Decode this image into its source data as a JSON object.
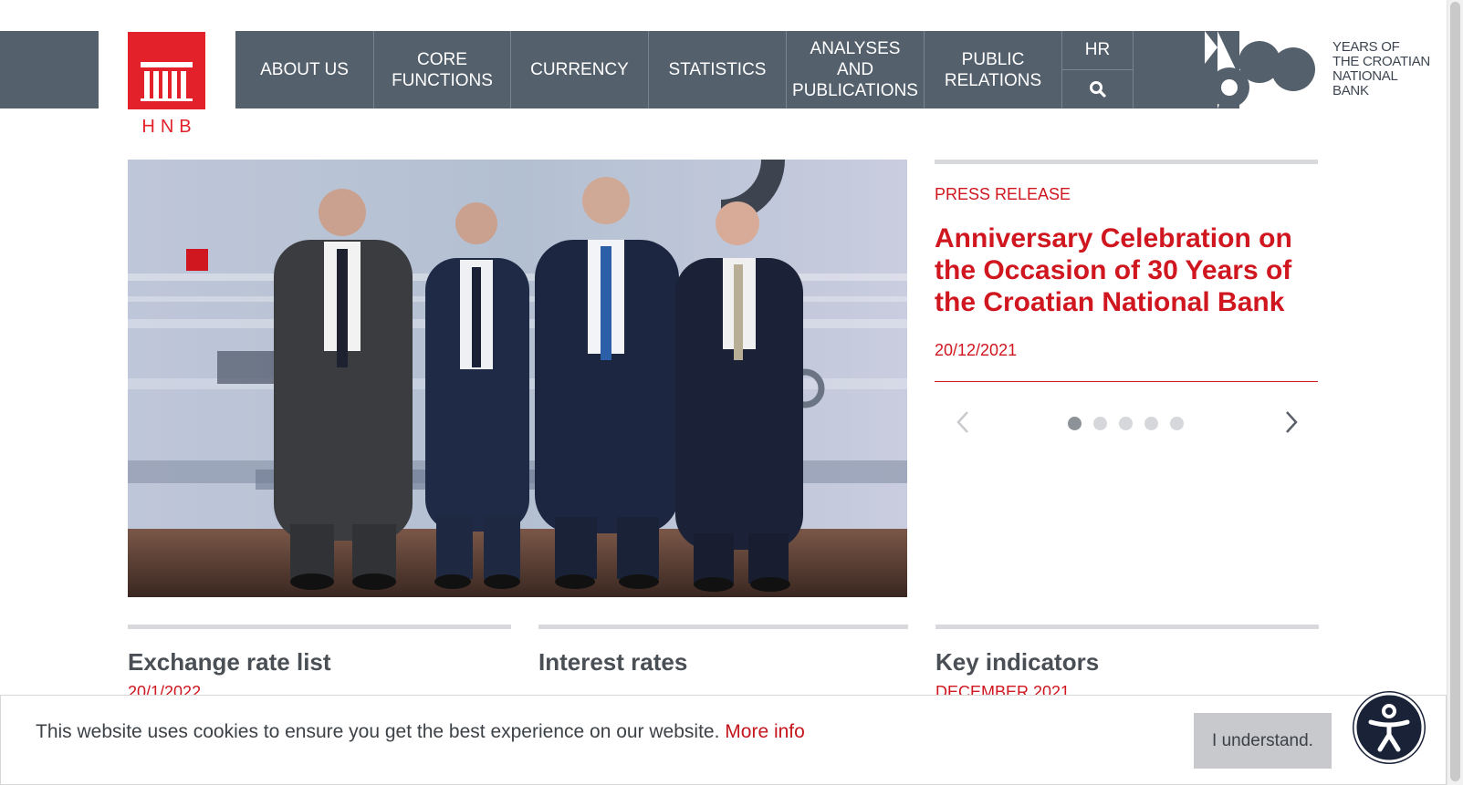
{
  "header": {
    "logo_text": "HNB",
    "nav": [
      {
        "label": "ABOUT US"
      },
      {
        "label": "CORE FUNCTIONS"
      },
      {
        "label": "CURRENCY"
      },
      {
        "label": "STATISTICS"
      },
      {
        "label": "ANALYSES AND PUBLICATIONS"
      },
      {
        "label": "PUBLIC RELATIONS"
      }
    ],
    "language": "HR",
    "search_icon": "search-icon",
    "anniversary": {
      "line1": "YEARS OF",
      "line2": "THE CROATIAN",
      "line3": "NATIONAL",
      "line4": "BANK",
      "number": "30"
    }
  },
  "hero": {
    "image": "anniversary-group-photo",
    "press": {
      "label": "PRESS RELEASE",
      "title": "Anniversary Celebration on the Occasion of 30 Years of the Croatian National Bank",
      "date": "20/12/2021"
    },
    "carousel": {
      "slides": 5,
      "active": 1
    }
  },
  "cards": [
    {
      "title": "Exchange rate list",
      "sub": "20/1/2022"
    },
    {
      "title": "Interest rates",
      "sub": ""
    },
    {
      "title": "Key indicators",
      "sub": "DECEMBER 2021"
    }
  ],
  "cookie": {
    "text": "This website uses cookies to ensure you get the best experience on our website.",
    "link": "More info",
    "button": "I understand."
  },
  "colors": {
    "nav_bg": "#55606d",
    "brand_red": "#e3212a",
    "accent_red": "#d0161f"
  }
}
